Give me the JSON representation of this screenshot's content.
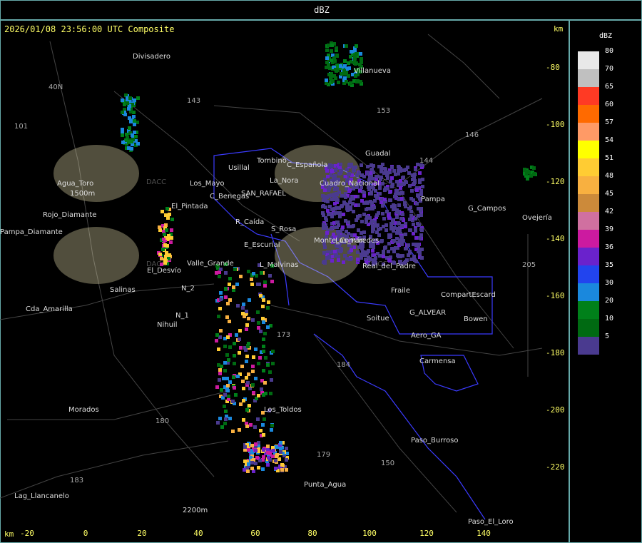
{
  "window": {
    "title": "dBZ"
  },
  "map": {
    "header": "2026/01/08 23:56:00 UTC Composite",
    "x_unit": "km",
    "y_unit": "km",
    "x_ticks": [
      "-20",
      "0",
      "20",
      "40",
      "60",
      "80",
      "100",
      "120",
      "140"
    ],
    "y_ticks": [
      "-80",
      "-100",
      "-120",
      "-140",
      "-160",
      "-180",
      "-200",
      "-220"
    ],
    "watermark": "DACC",
    "places": [
      "Divisadero",
      "Villanueva",
      "Tombino",
      "Usillal",
      "C_Española",
      "La_Nora",
      "Guadal",
      "Agua_Toro",
      "1500m",
      "Pampa_Diamante",
      "Rojo_Diamante",
      "El_Pintada",
      "Los_Mayo",
      "C_Benegas",
      "SAN_RAFAEL",
      "R_Caída",
      "S_Rosa",
      "E_Escurial",
      "Valle_Grande",
      "L_Malvinas",
      "El_Desvío",
      "Salinas",
      "Cda_Amarilla",
      "Nihuil",
      "N_1",
      "N_2",
      "Morados",
      "Los_Toldos",
      "Punta_Agua",
      "Lag_Llancanelo",
      "2200m",
      "Soitue",
      "G_ALVEAR",
      "Aero_GA",
      "Bowen",
      "CompartEscard",
      "Carmensa",
      "Paso_Burroso",
      "Paso_El_Loro",
      "G_Campos",
      "Ovejería",
      "Pampa",
      "Fraile",
      "Cuadro_Nacional",
      "Real_del_Padre",
      "Las_Paredes",
      "Monte_Comán"
    ],
    "routes": [
      "40N",
      "101",
      "143",
      "153",
      "146",
      "144",
      "173",
      "184",
      "180",
      "179",
      "150",
      "183",
      "205"
    ],
    "colors": {
      "boundary": "#3b3bff",
      "road": "#444444",
      "frame": "#66aaaa"
    }
  },
  "legend": {
    "title": "dBZ",
    "entries": [
      {
        "label": "80",
        "color": "#e8e8e8"
      },
      {
        "label": "70",
        "color": "#c0c0c0"
      },
      {
        "label": "65",
        "color": "#ff3a24"
      },
      {
        "label": "60",
        "color": "#ff6a00"
      },
      {
        "label": "57",
        "color": "#ff9a66"
      },
      {
        "label": "54",
        "color": "#ffff00"
      },
      {
        "label": "51",
        "color": "#ffcc33"
      },
      {
        "label": "48",
        "color": "#f8b040"
      },
      {
        "label": "45",
        "color": "#cc8a3a"
      },
      {
        "label": "42",
        "color": "#d070a0"
      },
      {
        "label": "39",
        "color": "#cc1aa0"
      },
      {
        "label": "36",
        "color": "#6a22cc"
      },
      {
        "label": "35",
        "color": "#2244ee"
      },
      {
        "label": "30",
        "color": "#1a88dd"
      },
      {
        "label": "20",
        "color": "#00801a"
      },
      {
        "label": "10",
        "color": "#006a12"
      },
      {
        "label": "5",
        "color": "#4a3a8f"
      }
    ]
  }
}
